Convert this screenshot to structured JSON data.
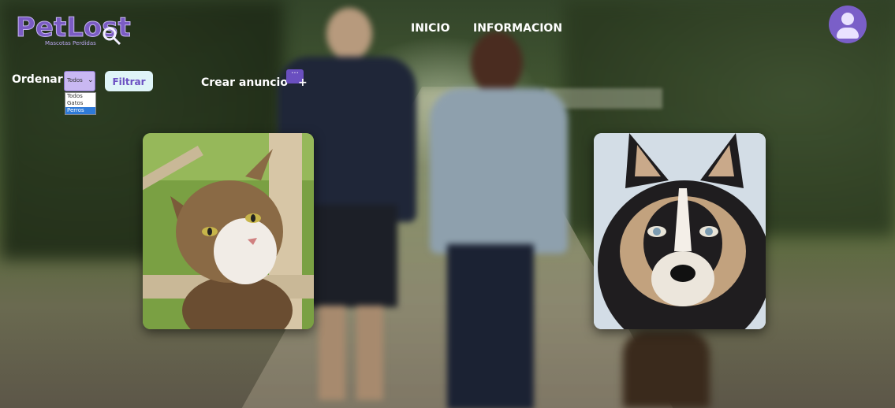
{
  "brand": {
    "name": "PetLost",
    "tagline": "Mascotas Perdidas"
  },
  "nav": {
    "inicio": "INICIO",
    "informacion": "INFORMACION"
  },
  "controls": {
    "sort_label": "Ordenar:",
    "sort_value": "Todos",
    "sort_options": [
      "Todos",
      "Gatos",
      "Perros"
    ],
    "highlighted_option": "Perros",
    "filter_button": "Filtrar",
    "create_ad": "Crear anuncio"
  },
  "pets": [
    {
      "kind": "cat"
    },
    {
      "kind": "dog"
    }
  ],
  "colors": {
    "brand_purple": "#7b5cc4",
    "button_bg": "#dff4f8",
    "avatar": "#7a5fc8"
  },
  "icons": {
    "avatar": "user-avatar-icon",
    "create": "add-message-icon",
    "logo": "magnifier-icon"
  }
}
